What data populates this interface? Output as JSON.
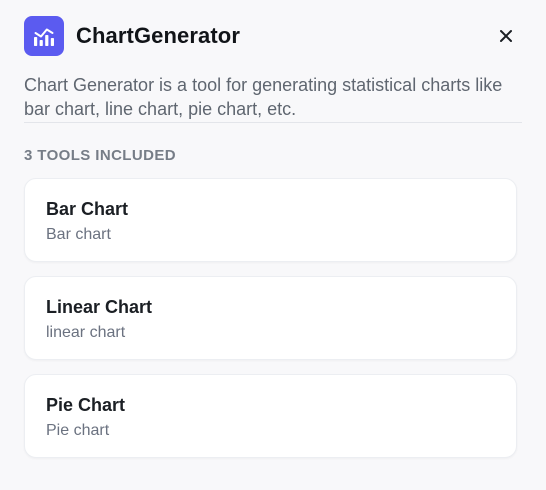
{
  "header": {
    "title": "ChartGenerator",
    "logo_icon": "bar-chart-icon",
    "close_icon": "close-icon",
    "accent_color": "#5b5bf0"
  },
  "description": "Chart Generator is a tool for generating statistical charts like bar chart, line chart, pie chart, etc.",
  "tools_section": {
    "label": "3 TOOLS INCLUDED",
    "tools": [
      {
        "name": "Bar Chart",
        "desc": "Bar chart"
      },
      {
        "name": "Linear Chart",
        "desc": "linear chart"
      },
      {
        "name": "Pie Chart",
        "desc": "Pie chart"
      }
    ]
  }
}
